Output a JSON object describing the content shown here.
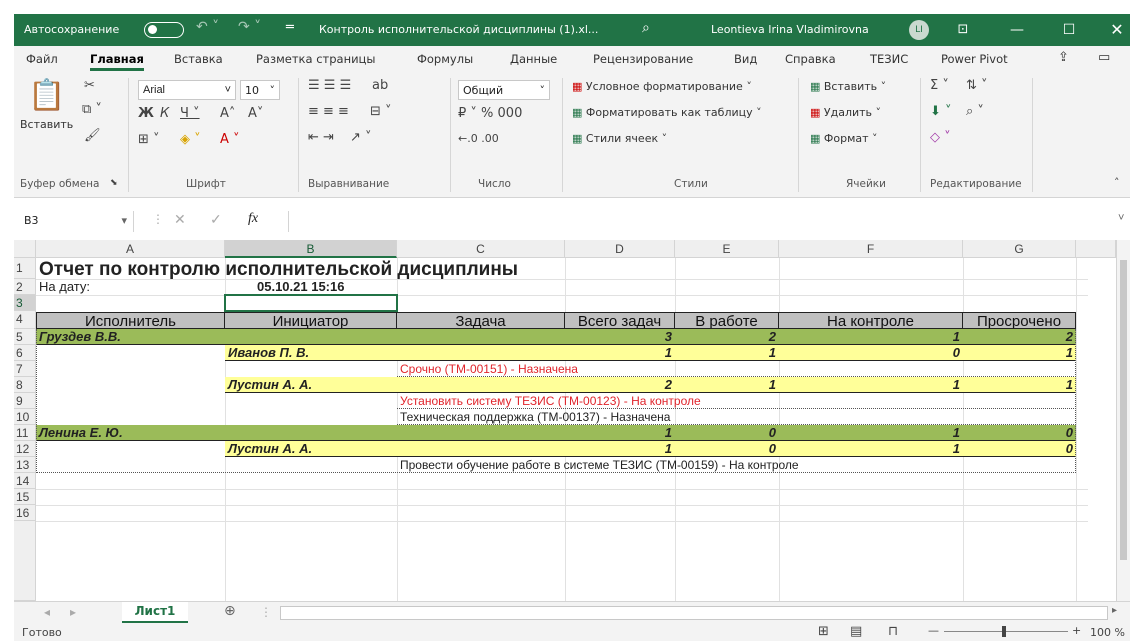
{
  "titlebar": {
    "autosave": "Автосохранение",
    "filename": "Контроль исполнительской дисциплины (1).xl...",
    "user": "Leontieva Irina Vladimirovna",
    "initials": "LI"
  },
  "menu": [
    "Файл",
    "Главная",
    "Вставка",
    "Разметка страницы",
    "Формулы",
    "Данные",
    "Рецензирование",
    "Вид",
    "Справка",
    "ТЕЗИС",
    "Power Pivot"
  ],
  "ribbon": {
    "paste": "Вставить",
    "font_name": "Arial",
    "font_size": "10",
    "number_format": "Общий",
    "cond_format": "Условное форматирование ˅",
    "format_table": "Форматировать как таблицу ˅",
    "cell_styles": "Стили ячеек ˅",
    "insert": "Вставить ˅",
    "delete": "Удалить ˅",
    "format": "Формат ˅",
    "groups": {
      "clipboard": "Буфер обмена",
      "font": "Шрифт",
      "alignment": "Выравнивание",
      "number": "Число",
      "styles": "Стили",
      "cells": "Ячейки",
      "editing": "Редактирование"
    }
  },
  "formula": {
    "namebox": "B3",
    "fx": "fx",
    "value": ""
  },
  "columns": [
    "A",
    "B",
    "C",
    "D",
    "E",
    "F",
    "G"
  ],
  "rows": [
    "1",
    "2",
    "3",
    "4",
    "5",
    "6",
    "7",
    "8",
    "9",
    "10",
    "11",
    "12",
    "13",
    "14",
    "15",
    "16"
  ],
  "sheet": {
    "title": "Отчет по контролю исполнительской дисциплины",
    "date_label": "На дату:",
    "date_value": "05.10.21 15:16",
    "headers": [
      "Исполнитель",
      "Инициатор",
      "Задача",
      "Всего задач",
      "В работе",
      "На контроле",
      "Просрочено"
    ],
    "r5": {
      "a": "Груздев В.В.",
      "d": "3",
      "e": "2",
      "f": "1",
      "g": "2"
    },
    "r6": {
      "b": "Иванов П. В.",
      "d": "1",
      "e": "1",
      "f": "0",
      "g": "1"
    },
    "r7": {
      "c": "Срочно (ТМ-00151) - Назначена"
    },
    "r8": {
      "b": "Лустин А. А.",
      "d": "2",
      "e": "1",
      "f": "1",
      "g": "1"
    },
    "r9": {
      "c": "Установить систему ТЕЗИС (ТМ-00123) - На контроле"
    },
    "r10": {
      "c": "Техническая поддержка (ТМ-00137) - Назначена"
    },
    "r11": {
      "a": "Ленина Е. Ю.",
      "d": "1",
      "e": "0",
      "f": "1",
      "g": "0"
    },
    "r12": {
      "b": "Лустин А. А.",
      "d": "1",
      "e": "0",
      "f": "1",
      "g": "0"
    },
    "r13": {
      "c": "Провести обучение работе в системе ТЕЗИС (ТМ-00159) - На контроле"
    }
  },
  "tab": "Лист1",
  "status": {
    "ready": "Готово",
    "zoom": "100 %"
  },
  "colors": {
    "accent": "#217346",
    "green_band": "#9bbb59",
    "yellow_band": "#ffff99",
    "header_gray": "#c0c0c0",
    "red_text": "#e0242b"
  }
}
